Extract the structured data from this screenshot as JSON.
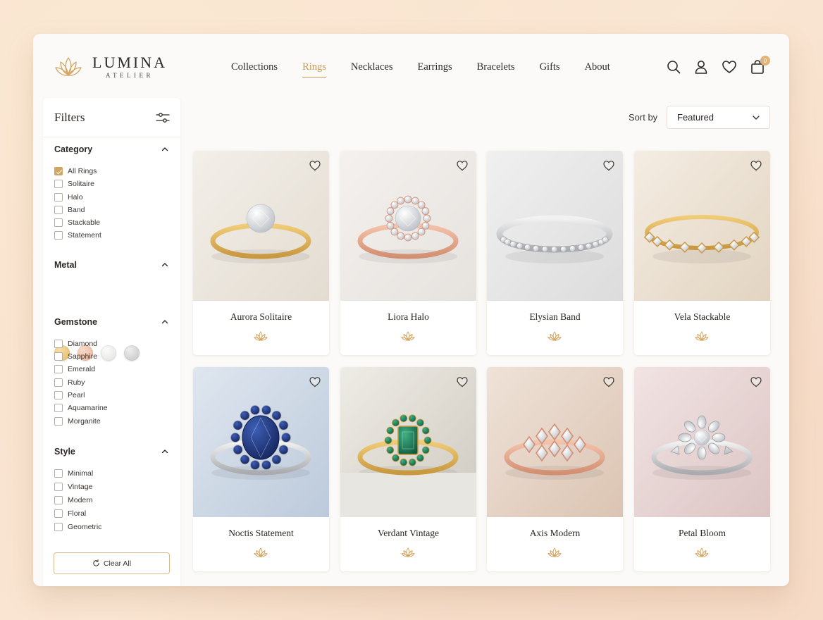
{
  "brand": {
    "name": "LUMINA",
    "sub": "ATELIER"
  },
  "nav": {
    "items": [
      "Collections",
      "Rings",
      "Necklaces",
      "Earrings",
      "Bracelets",
      "Gifts",
      "About"
    ],
    "active": "Rings"
  },
  "header_icons": [
    "search-icon",
    "user-icon",
    "heart-icon",
    "bag-icon"
  ],
  "cart": {
    "count": "0"
  },
  "filters": {
    "title": "Filters",
    "category": {
      "title": "Category",
      "options": [
        "All Rings",
        "Solitaire",
        "Halo",
        "Band",
        "Stackable",
        "Statement"
      ],
      "checked": [
        "All Rings"
      ]
    },
    "metal": {
      "title": "Metal",
      "swatches": [
        "#e6c27a",
        "#efc2ad",
        "#ecebea",
        "#cfd0d1"
      ]
    },
    "gemstone": {
      "title": "Gemstone",
      "options": [
        "Diamond",
        "Sapphire",
        "Emerald",
        "Ruby",
        "Pearl",
        "Aquamarine",
        "Morganite"
      ]
    },
    "style": {
      "title": "Style",
      "options": [
        "Minimal",
        "Vintage",
        "Modern",
        "Floral",
        "Geometric"
      ]
    },
    "clear_label": "Clear All"
  },
  "sort": {
    "label": "Sort by",
    "value": "Featured"
  },
  "products": [
    {
      "name": "Aurora Solitaire",
      "metal": "gold",
      "stone": "diamond",
      "style": "solitaire"
    },
    {
      "name": "Liora Halo",
      "metal": "rose",
      "stone": "diamond",
      "style": "halo"
    },
    {
      "name": "Elysian Band",
      "metal": "silver",
      "stone": "diamond",
      "style": "band"
    },
    {
      "name": "Vela Stackable",
      "metal": "gold",
      "stone": "diamond",
      "style": "stackable"
    },
    {
      "name": "Noctis Statement",
      "metal": "silver",
      "stone": "sapphire",
      "style": "halo-big"
    },
    {
      "name": "Verdant Vintage",
      "metal": "gold",
      "stone": "emerald",
      "style": "halo-emerald"
    },
    {
      "name": "Axis Modern",
      "metal": "rose",
      "stone": "diamond",
      "style": "geometric"
    },
    {
      "name": "Petal Bloom",
      "metal": "silver",
      "stone": "diamond",
      "style": "floral"
    }
  ],
  "colors": {
    "accent": "#c99a57",
    "text": "#2c2724",
    "checkbox": "#d4a561"
  }
}
